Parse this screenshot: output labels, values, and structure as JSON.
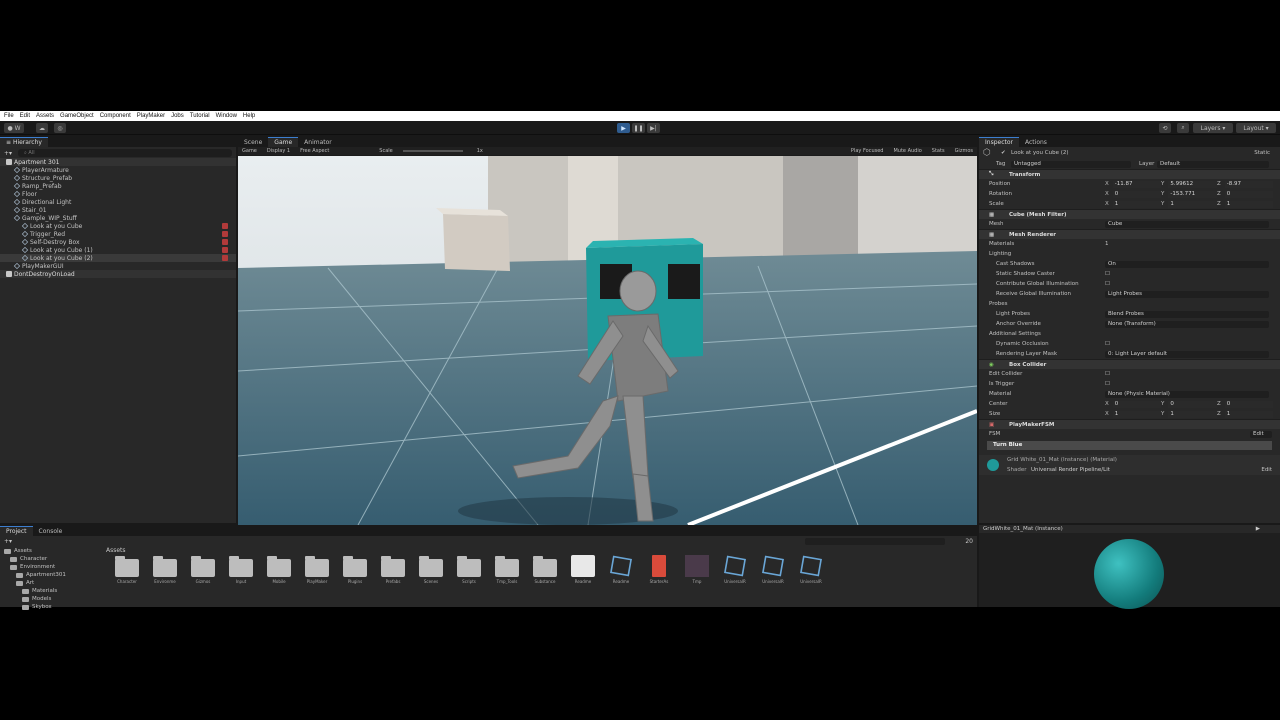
{
  "menu": [
    "File",
    "Edit",
    "Assets",
    "GameObject",
    "Component",
    "PlayMaker",
    "Jobs",
    "Tutorial",
    "Window",
    "Help"
  ],
  "toolbar": {
    "account": "W",
    "layers": "Layers",
    "layout": "Layout"
  },
  "hierarchy": {
    "tab": "Hierarchy",
    "search_placeholder": "All",
    "items": [
      {
        "label": "Apartment 301",
        "depth": 0,
        "kind": "scene"
      },
      {
        "label": "PlayerArmature",
        "depth": 1,
        "kind": "obj"
      },
      {
        "label": "Structure_Prefab",
        "depth": 1,
        "kind": "obj"
      },
      {
        "label": "Ramp_Prefab",
        "depth": 1,
        "kind": "obj"
      },
      {
        "label": "Floor",
        "depth": 1,
        "kind": "obj"
      },
      {
        "label": "Directional Light",
        "depth": 1,
        "kind": "obj"
      },
      {
        "label": "Stair_01",
        "depth": 1,
        "kind": "obj"
      },
      {
        "label": "Gample_WIP_Stuff",
        "depth": 1,
        "kind": "obj"
      },
      {
        "label": "Look at you Cube",
        "depth": 2,
        "kind": "fsm"
      },
      {
        "label": "Trigger_Red",
        "depth": 2,
        "kind": "fsm"
      },
      {
        "label": "Self-Destroy Box",
        "depth": 2,
        "kind": "fsm"
      },
      {
        "label": "Look at you Cube (1)",
        "depth": 2,
        "kind": "fsm"
      },
      {
        "label": "Look at you Cube (2)",
        "depth": 2,
        "kind": "fsm-selected"
      },
      {
        "label": "PlayMakerGUI",
        "depth": 1,
        "kind": "obj"
      },
      {
        "label": "DontDestroyOnLoad",
        "depth": 0,
        "kind": "scene"
      }
    ]
  },
  "view_tabs": [
    "Scene",
    "Game",
    "Animator"
  ],
  "game_toolbar": {
    "mode": "Game",
    "display": "Display 1",
    "aspect": "Free Aspect",
    "scale_label": "Scale",
    "scale_value": "1x",
    "play_focused": "Play Focused",
    "mute": "Mute Audio",
    "stats": "Stats",
    "gizmos": "Gizmos"
  },
  "inspector": {
    "tabs": [
      "Inspector",
      "Actions"
    ],
    "object_name": "Look at you Cube (2)",
    "static_label": "Static",
    "tag_label": "Tag",
    "tag": "Untagged",
    "layer_label": "Layer",
    "layer": "Default",
    "transform": {
      "title": "Transform",
      "position": {
        "label": "Position",
        "x": "-11.87",
        "y": "5.99612",
        "z": "-8.97"
      },
      "rotation": {
        "label": "Rotation",
        "x": "0",
        "y": "-153.771",
        "z": "0"
      },
      "scale": {
        "label": "Scale",
        "x": "1",
        "y": "1",
        "z": "1"
      }
    },
    "mesh_filter": {
      "title": "Cube (Mesh Filter)",
      "mesh_label": "Mesh",
      "mesh": "Cube"
    },
    "mesh_renderer": {
      "title": "Mesh Renderer",
      "materials_label": "Materials",
      "materials_count": "1",
      "lighting_label": "Lighting",
      "cast_shadows_label": "Cast Shadows",
      "cast_shadows": "On",
      "static_shadow_label": "Static Shadow Caster",
      "contribute_gi_label": "Contribute Global Illumination",
      "receive_gi_label": "Receive Global Illumination",
      "receive_gi": "Light Probes",
      "probes_label": "Probes",
      "light_probes_label": "Light Probes",
      "light_probes": "Blend Probes",
      "anchor_override_label": "Anchor Override",
      "anchor_override": "None (Transform)",
      "additional_label": "Additional Settings",
      "dynamic_occlusion_label": "Dynamic Occlusion",
      "rendering_layer_label": "Rendering Layer Mask",
      "rendering_layer": "0: Light Layer default"
    },
    "box_collider": {
      "title": "Box Collider",
      "edit_collider_label": "Edit Collider",
      "is_trigger_label": "Is Trigger",
      "material_label": "Material",
      "material": "None (Physic Material)",
      "center": {
        "label": "Center",
        "x": "0",
        "y": "0",
        "z": "0"
      },
      "size": {
        "label": "Size",
        "x": "1",
        "y": "1",
        "z": "1"
      }
    },
    "playmaker": {
      "title": "PlayMakerFSM",
      "fsm_label": "FSM",
      "edit_label": "Edit",
      "state": "Turn Blue"
    },
    "material_block": {
      "title": "Grid White_01_Mat (Instance) (Material)",
      "shader_label": "Shader",
      "shader": "Universal Render Pipeline/Lit",
      "edit_label": "Edit"
    }
  },
  "project": {
    "tabs": [
      "Project",
      "Console"
    ],
    "breadcrumb": "Assets",
    "badge": "20",
    "tree": [
      {
        "label": "Assets",
        "depth": 0
      },
      {
        "label": "Character",
        "depth": 1
      },
      {
        "label": "Environment",
        "depth": 1
      },
      {
        "label": "Apartment301",
        "depth": 2
      },
      {
        "label": "Art",
        "depth": 2
      },
      {
        "label": "Materials",
        "depth": 3
      },
      {
        "label": "Models",
        "depth": 3
      },
      {
        "label": "Skybox",
        "depth": 3
      }
    ],
    "assets": [
      {
        "label": "Character",
        "kind": "folder"
      },
      {
        "label": "Environme",
        "kind": "folder"
      },
      {
        "label": "Gizmos",
        "kind": "folder"
      },
      {
        "label": "Input",
        "kind": "folder"
      },
      {
        "label": "Mobile",
        "kind": "folder"
      },
      {
        "label": "PlayMaker",
        "kind": "folder"
      },
      {
        "label": "Plugins",
        "kind": "folder"
      },
      {
        "label": "Prefabs",
        "kind": "folder"
      },
      {
        "label": "Scenes",
        "kind": "folder"
      },
      {
        "label": "Scripts",
        "kind": "folder"
      },
      {
        "label": "Tmp_Tools",
        "kind": "folder"
      },
      {
        "label": "Substance",
        "kind": "folder"
      },
      {
        "label": "Readme",
        "kind": "doc"
      },
      {
        "label": "Readme",
        "kind": "script"
      },
      {
        "label": "StarterAs",
        "kind": "pdf"
      },
      {
        "label": "Tmp",
        "kind": "dark"
      },
      {
        "label": "UniversalR",
        "kind": "script"
      },
      {
        "label": "UniversalR",
        "kind": "script"
      },
      {
        "label": "UniversalR",
        "kind": "script"
      }
    ]
  },
  "preview": {
    "title": "GridWhite_01_Mat (Instance)"
  },
  "colors": {
    "accent": "#3c7ecf",
    "teal": "#1f9a9a",
    "play": "#2f5c8f"
  }
}
